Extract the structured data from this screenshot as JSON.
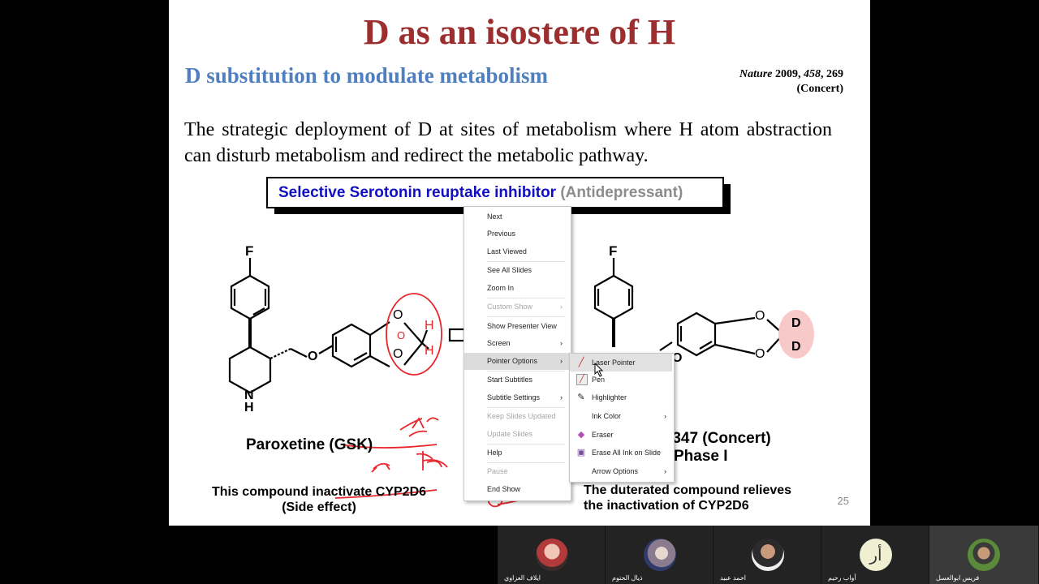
{
  "slide": {
    "title": "D as an isostere of H",
    "subtitle": "D substitution to modulate metabolism",
    "reference": {
      "journal": "Nature",
      "year": "2009,",
      "volume": "458",
      "page": ", 269",
      "source": "(Concert)"
    },
    "body": "The strategic deployment of D at sites of metabolism where H atom abstraction can disturb metabolism and redirect the metabolic pathway.",
    "ssri_box": {
      "main": "Selective Serotonin reuptake inhibitor",
      "paren": "(Antidepressant)"
    },
    "left_molecule": {
      "atom_f": "F",
      "atom_nh": "N",
      "atom_h": "H",
      "atom_o": "O",
      "h1": "H",
      "h2": "H",
      "name": "Paroxetine (GSK)",
      "note_line1": "This compound inactivate CYP2D6",
      "note_line2": "(Side effect)"
    },
    "right_molecule": {
      "atom_f": "F",
      "atom_o": "O",
      "d1": "D",
      "d2": "D",
      "name_partial": "-347  (Concert)",
      "phase_partial": "Phase I",
      "note_line1": "The duterated compound relieves",
      "note_line2": "the inactivation of CYP2D6"
    },
    "page_number": "25"
  },
  "context_menu": {
    "items": [
      {
        "label": "Next",
        "disabled": false
      },
      {
        "label": "Previous",
        "disabled": false
      },
      {
        "label": "Last Viewed",
        "disabled": false
      },
      {
        "label": "See All Slides",
        "disabled": false
      },
      {
        "label": "Zoom In",
        "disabled": false
      },
      {
        "label": "Custom Show",
        "disabled": true
      },
      {
        "label": "Show Presenter View",
        "disabled": false
      },
      {
        "label": "Screen",
        "disabled": false
      },
      {
        "label": "Pointer Options",
        "disabled": false
      },
      {
        "label": "Start Subtitles",
        "disabled": false
      },
      {
        "label": "Subtitle Settings",
        "disabled": false
      },
      {
        "label": "Keep Slides Updated",
        "disabled": true
      },
      {
        "label": "Update Slides",
        "disabled": true
      },
      {
        "label": "Help",
        "disabled": false
      },
      {
        "label": "Pause",
        "disabled": true
      },
      {
        "label": "End Show",
        "disabled": false
      }
    ]
  },
  "pointer_submenu": {
    "items": [
      {
        "label": "Laser Pointer",
        "icon": "laser-pointer-icon"
      },
      {
        "label": "Pen",
        "icon": "pen-icon"
      },
      {
        "label": "Highlighter",
        "icon": "highlighter-icon"
      },
      {
        "label": "Ink Color",
        "icon": ""
      },
      {
        "label": "Eraser",
        "icon": "eraser-icon"
      },
      {
        "label": "Erase All Ink on Slide",
        "icon": "erase-all-icon"
      },
      {
        "label": "Arrow Options",
        "icon": ""
      }
    ]
  },
  "participants": [
    {
      "name": "ايلاف العزاوي"
    },
    {
      "name": "ذيال الحتوم"
    },
    {
      "name": "احمد عبيد"
    },
    {
      "name": "أواب رحيم",
      "initial": "أر"
    },
    {
      "name": "فريس ابوالعسل"
    }
  ],
  "colors": {
    "title": "#9b2f2f",
    "subtitle": "#4f7fbf",
    "ssri_blue": "#1010c0",
    "ink_red": "#e8262c",
    "background": "#000000"
  }
}
